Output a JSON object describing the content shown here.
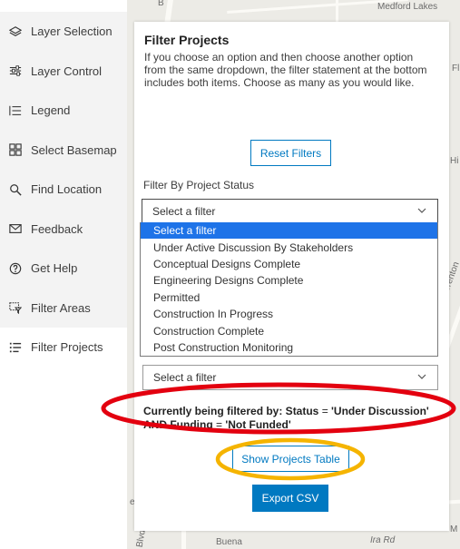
{
  "map": {
    "labels": [
      "Medford Lakes",
      "Fl",
      "Hi",
      "Brenton",
      "Buena",
      "Blvd",
      "Ira Rd",
      "M",
      "e",
      "B"
    ]
  },
  "sidebar": {
    "items": [
      {
        "label": "Layer Selection",
        "icon": "layers-icon"
      },
      {
        "label": "Layer Control",
        "icon": "sliders-icon"
      },
      {
        "label": "Legend",
        "icon": "list-icon"
      },
      {
        "label": "Select Basemap",
        "icon": "grid-icon"
      },
      {
        "label": "Find Location",
        "icon": "search-icon"
      },
      {
        "label": "Feedback",
        "icon": "envelope-icon"
      },
      {
        "label": "Get Help",
        "icon": "help-icon"
      },
      {
        "label": "Filter Areas",
        "icon": "area-filter-icon"
      },
      {
        "label": "Filter Projects",
        "icon": "filter-list-icon"
      }
    ]
  },
  "panel": {
    "title": "Filter Projects",
    "description": "If you choose an option and then choose another option from the same dropdown, the filter statement at the bottom includes both items. Choose as many as you would like.",
    "reset_label": "Reset Filters",
    "status_label": "Filter By Project Status",
    "status_select_value": "Select a filter",
    "status_options": [
      "Select a filter",
      "Under Active Discussion By Stakeholders",
      "Conceptual Designs Complete",
      "Engineering Designs Complete",
      "Permitted",
      "Construction In Progress",
      "Construction Complete",
      "Post Construction Monitoring"
    ],
    "second_select_value": "Select a filter",
    "filter_prefix": "Currently being filtered by: Status",
    "filter_eq1": " = ",
    "filter_val1": "'Under Discussion'",
    "filter_and": "AND Funding",
    "filter_eq2": " = ",
    "filter_val2": "'Not Funded'",
    "show_table_label": "Show Projects Table",
    "export_label": "Export CSV"
  },
  "colors": {
    "accent": "#0079c1",
    "highlight_option": "#1e73e8",
    "annotation_red": "#e3000f",
    "annotation_orange": "#f5b400"
  }
}
